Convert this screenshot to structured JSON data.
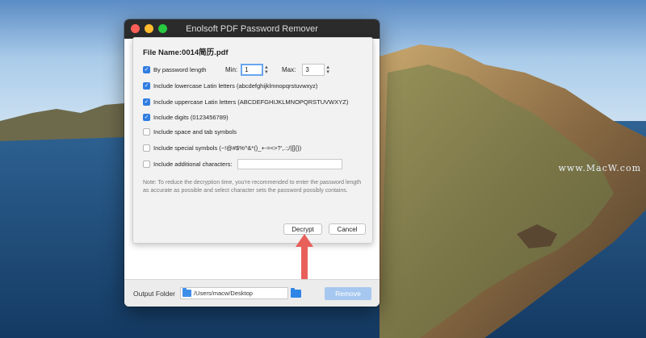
{
  "window": {
    "title": "Enolsoft PDF Password Remover"
  },
  "dialog": {
    "file_name_label": "File Name:",
    "file_name": "0014简历.pdf",
    "options": [
      {
        "label": "By password length",
        "checked": true
      },
      {
        "label": "Include lowercase Latin letters (abcdefghijklmnopqrstuvwxyz)",
        "checked": true
      },
      {
        "label": "Include uppercase Latin letters (ABCDEFGHIJKLMNOPQRSTUVWXYZ)",
        "checked": true
      },
      {
        "label": "Include digits (0123456789)",
        "checked": true
      },
      {
        "label": "Include space and tab symbols",
        "checked": false
      },
      {
        "label": "Include special symbols (~!@#$%^&*()_+-=<>?',.:;/|[]{})",
        "checked": false
      },
      {
        "label": "Include additional characters:",
        "checked": false
      }
    ],
    "min_label": "Min:",
    "min_value": "1",
    "max_label": "Max:",
    "max_value": "3",
    "additional_value": "",
    "note": "Note: To reduce the decryption time, you're recommended to enter the password length as accurate as possible and select character sets the password possibly contains.",
    "decrypt_label": "Decrypt",
    "cancel_label": "Cancel"
  },
  "footer": {
    "output_folder_label": "Output Folder",
    "folder_path": "/Users/macw/Desktop",
    "remove_label": "Remove"
  },
  "watermark": "www.MacW.com",
  "colors": {
    "accent": "#2f7de1",
    "arrow": "#e8605a",
    "remove_disabled": "#a6c8f0"
  },
  "icons": [
    "folder-icon",
    "browse-folder-icon",
    "checkbox-checked-icon",
    "stepper-icon",
    "red-arrow"
  ]
}
